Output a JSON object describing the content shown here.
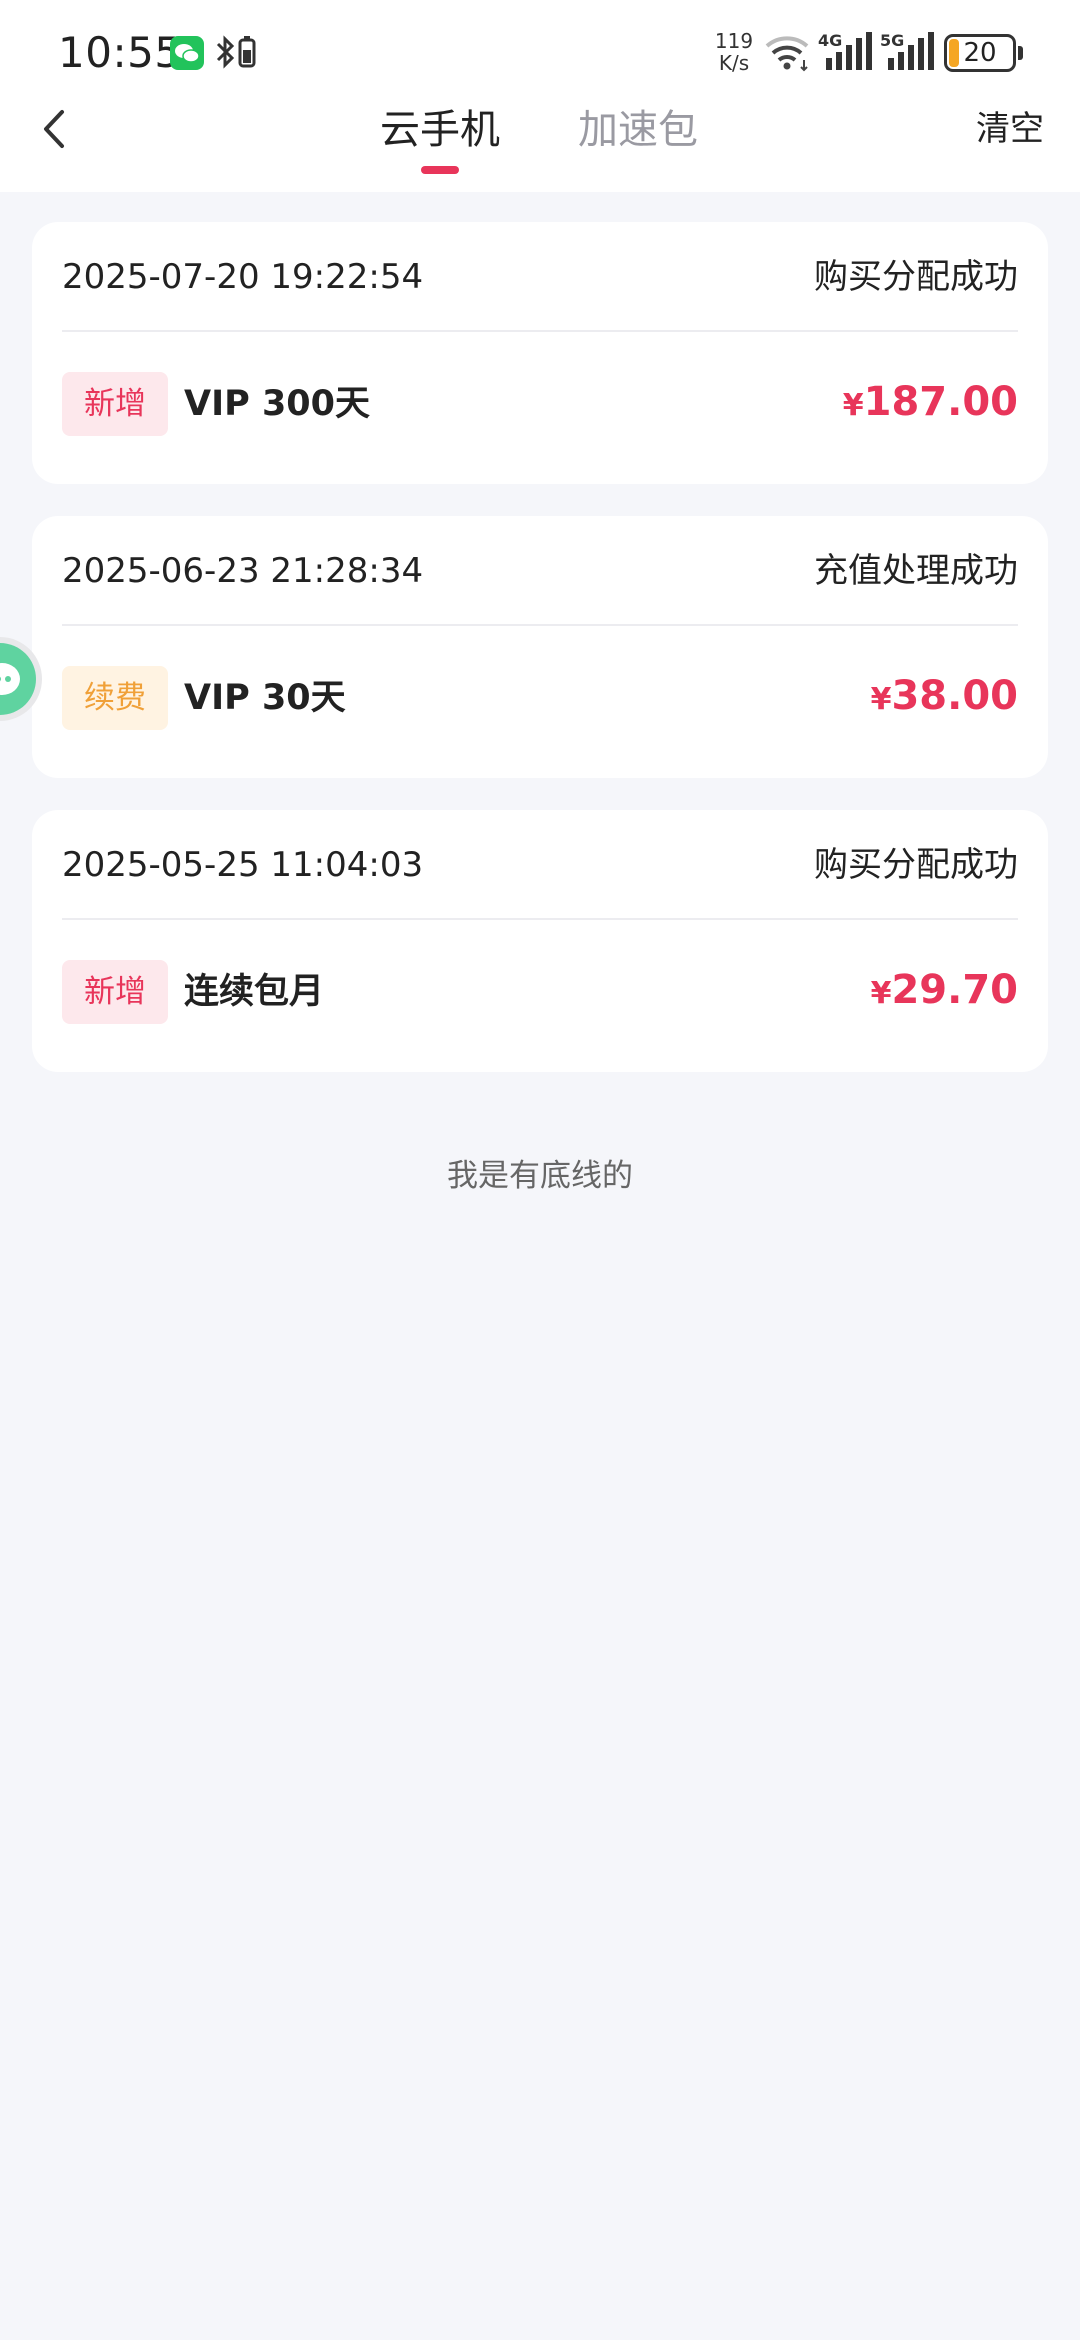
{
  "status_bar": {
    "time": "10:55",
    "net_speed_value": "119",
    "net_speed_unit": "K/s",
    "battery": "20",
    "icons": [
      "wechat-icon",
      "bluetooth-icon",
      "wifi-icon",
      "signal-4g-icon",
      "signal-5g-icon",
      "battery-icon"
    ]
  },
  "nav": {
    "back_icon": "chevron-left-icon",
    "tabs": [
      {
        "label": "云手机",
        "active": true
      },
      {
        "label": "加速包",
        "active": false
      }
    ],
    "clear_label": "清空"
  },
  "orders": [
    {
      "datetime": "2025-07-20 19:22:54",
      "status": "购买分配成功",
      "tag": "新增",
      "item": "VIP 300天",
      "currency": "¥",
      "amount": "187.00"
    },
    {
      "datetime": "2025-06-23 21:28:34",
      "status": "充值处理成功",
      "tag": "续费",
      "item": "VIP 30天",
      "currency": "¥",
      "amount": "38.00"
    },
    {
      "datetime": "2025-05-25 11:04:03",
      "status": "购买分配成功",
      "tag": "新增",
      "item": "连续包月",
      "currency": "¥",
      "amount": "29.70"
    }
  ],
  "footer": "我是有底线的",
  "colors": {
    "accent": "#e8355a",
    "tag_new_bg": "#fde8ec",
    "tag_renew_bg": "#fff3e2",
    "tag_renew_text": "#f0a038",
    "page_bg": "#f5f6fa"
  }
}
